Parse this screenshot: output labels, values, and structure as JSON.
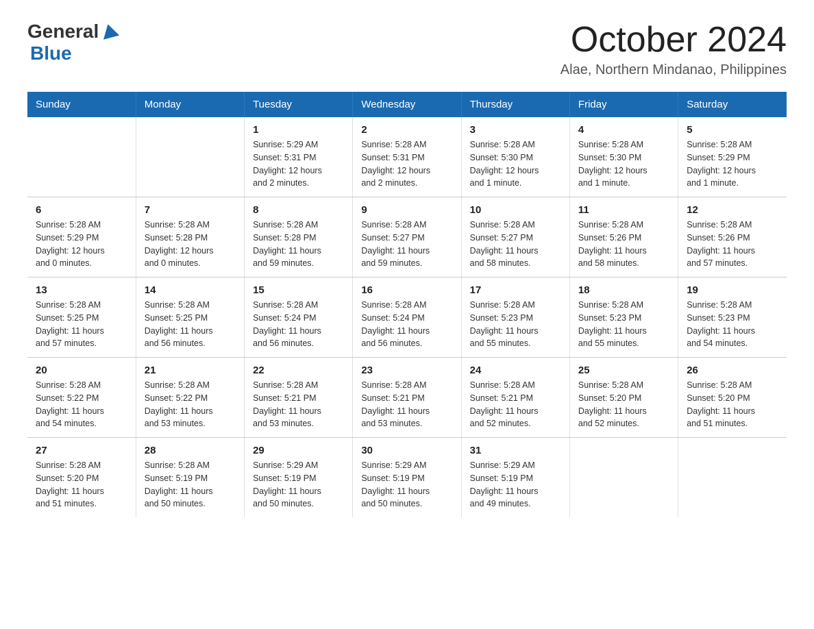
{
  "header": {
    "logo_general": "General",
    "logo_blue": "Blue",
    "title": "October 2024",
    "subtitle": "Alae, Northern Mindanao, Philippines"
  },
  "calendar": {
    "days_of_week": [
      "Sunday",
      "Monday",
      "Tuesday",
      "Wednesday",
      "Thursday",
      "Friday",
      "Saturday"
    ],
    "weeks": [
      [
        {
          "day": "",
          "info": ""
        },
        {
          "day": "",
          "info": ""
        },
        {
          "day": "1",
          "info": "Sunrise: 5:29 AM\nSunset: 5:31 PM\nDaylight: 12 hours\nand 2 minutes."
        },
        {
          "day": "2",
          "info": "Sunrise: 5:28 AM\nSunset: 5:31 PM\nDaylight: 12 hours\nand 2 minutes."
        },
        {
          "day": "3",
          "info": "Sunrise: 5:28 AM\nSunset: 5:30 PM\nDaylight: 12 hours\nand 1 minute."
        },
        {
          "day": "4",
          "info": "Sunrise: 5:28 AM\nSunset: 5:30 PM\nDaylight: 12 hours\nand 1 minute."
        },
        {
          "day": "5",
          "info": "Sunrise: 5:28 AM\nSunset: 5:29 PM\nDaylight: 12 hours\nand 1 minute."
        }
      ],
      [
        {
          "day": "6",
          "info": "Sunrise: 5:28 AM\nSunset: 5:29 PM\nDaylight: 12 hours\nand 0 minutes."
        },
        {
          "day": "7",
          "info": "Sunrise: 5:28 AM\nSunset: 5:28 PM\nDaylight: 12 hours\nand 0 minutes."
        },
        {
          "day": "8",
          "info": "Sunrise: 5:28 AM\nSunset: 5:28 PM\nDaylight: 11 hours\nand 59 minutes."
        },
        {
          "day": "9",
          "info": "Sunrise: 5:28 AM\nSunset: 5:27 PM\nDaylight: 11 hours\nand 59 minutes."
        },
        {
          "day": "10",
          "info": "Sunrise: 5:28 AM\nSunset: 5:27 PM\nDaylight: 11 hours\nand 58 minutes."
        },
        {
          "day": "11",
          "info": "Sunrise: 5:28 AM\nSunset: 5:26 PM\nDaylight: 11 hours\nand 58 minutes."
        },
        {
          "day": "12",
          "info": "Sunrise: 5:28 AM\nSunset: 5:26 PM\nDaylight: 11 hours\nand 57 minutes."
        }
      ],
      [
        {
          "day": "13",
          "info": "Sunrise: 5:28 AM\nSunset: 5:25 PM\nDaylight: 11 hours\nand 57 minutes."
        },
        {
          "day": "14",
          "info": "Sunrise: 5:28 AM\nSunset: 5:25 PM\nDaylight: 11 hours\nand 56 minutes."
        },
        {
          "day": "15",
          "info": "Sunrise: 5:28 AM\nSunset: 5:24 PM\nDaylight: 11 hours\nand 56 minutes."
        },
        {
          "day": "16",
          "info": "Sunrise: 5:28 AM\nSunset: 5:24 PM\nDaylight: 11 hours\nand 56 minutes."
        },
        {
          "day": "17",
          "info": "Sunrise: 5:28 AM\nSunset: 5:23 PM\nDaylight: 11 hours\nand 55 minutes."
        },
        {
          "day": "18",
          "info": "Sunrise: 5:28 AM\nSunset: 5:23 PM\nDaylight: 11 hours\nand 55 minutes."
        },
        {
          "day": "19",
          "info": "Sunrise: 5:28 AM\nSunset: 5:23 PM\nDaylight: 11 hours\nand 54 minutes."
        }
      ],
      [
        {
          "day": "20",
          "info": "Sunrise: 5:28 AM\nSunset: 5:22 PM\nDaylight: 11 hours\nand 54 minutes."
        },
        {
          "day": "21",
          "info": "Sunrise: 5:28 AM\nSunset: 5:22 PM\nDaylight: 11 hours\nand 53 minutes."
        },
        {
          "day": "22",
          "info": "Sunrise: 5:28 AM\nSunset: 5:21 PM\nDaylight: 11 hours\nand 53 minutes."
        },
        {
          "day": "23",
          "info": "Sunrise: 5:28 AM\nSunset: 5:21 PM\nDaylight: 11 hours\nand 53 minutes."
        },
        {
          "day": "24",
          "info": "Sunrise: 5:28 AM\nSunset: 5:21 PM\nDaylight: 11 hours\nand 52 minutes."
        },
        {
          "day": "25",
          "info": "Sunrise: 5:28 AM\nSunset: 5:20 PM\nDaylight: 11 hours\nand 52 minutes."
        },
        {
          "day": "26",
          "info": "Sunrise: 5:28 AM\nSunset: 5:20 PM\nDaylight: 11 hours\nand 51 minutes."
        }
      ],
      [
        {
          "day": "27",
          "info": "Sunrise: 5:28 AM\nSunset: 5:20 PM\nDaylight: 11 hours\nand 51 minutes."
        },
        {
          "day": "28",
          "info": "Sunrise: 5:28 AM\nSunset: 5:19 PM\nDaylight: 11 hours\nand 50 minutes."
        },
        {
          "day": "29",
          "info": "Sunrise: 5:29 AM\nSunset: 5:19 PM\nDaylight: 11 hours\nand 50 minutes."
        },
        {
          "day": "30",
          "info": "Sunrise: 5:29 AM\nSunset: 5:19 PM\nDaylight: 11 hours\nand 50 minutes."
        },
        {
          "day": "31",
          "info": "Sunrise: 5:29 AM\nSunset: 5:19 PM\nDaylight: 11 hours\nand 49 minutes."
        },
        {
          "day": "",
          "info": ""
        },
        {
          "day": "",
          "info": ""
        }
      ]
    ]
  }
}
